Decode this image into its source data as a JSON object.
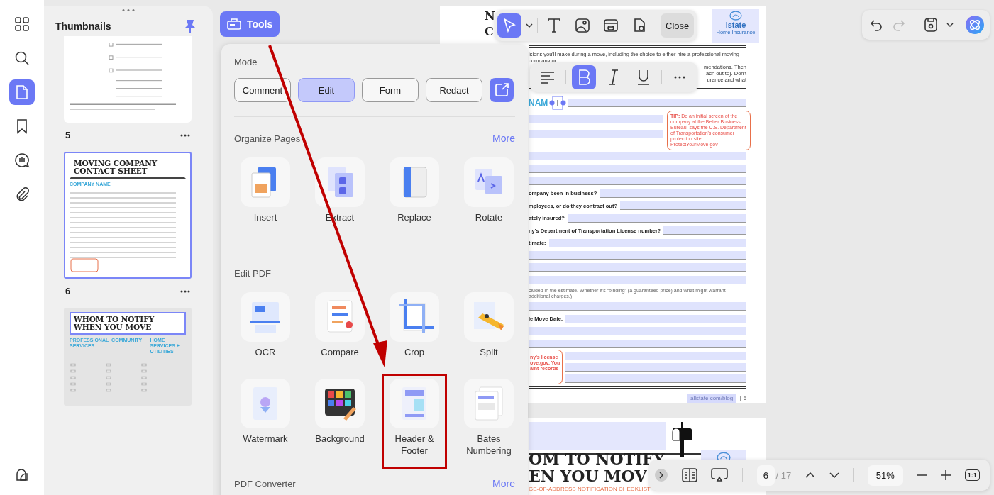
{
  "rail": {
    "items": [
      {
        "kind": "grid",
        "selected": false
      },
      {
        "kind": "search",
        "selected": false
      },
      {
        "kind": "pages",
        "selected": true
      },
      {
        "kind": "bookmark",
        "selected": false
      },
      {
        "kind": "comment",
        "selected": false
      },
      {
        "kind": "attachment",
        "selected": false
      }
    ]
  },
  "thumbnails": {
    "title": "Thumbnails",
    "pinned": true,
    "pages": [
      {
        "kind": "checklist",
        "label": "5",
        "selected": false
      },
      {
        "kind": "contact",
        "label": "6",
        "selected": true,
        "title": [
          "MOVING COMPANY",
          "CONTACT SHEET"
        ],
        "subtitle": "COMPANY NAME"
      },
      {
        "kind": "notify",
        "selected": false,
        "title_selected": true,
        "title": [
          "WHOM TO NOTIFY",
          "WHEN YOU MOVE"
        ],
        "columns": [
          "PROFESSIONAL SERVICES",
          "COMMUNITY",
          "HOME SERVICES + UTILITIES"
        ]
      }
    ]
  },
  "tools_button": {
    "label": "Tools",
    "selected": true
  },
  "panel": {
    "mode": {
      "title": "Mode",
      "buttons": [
        {
          "label": "Comment",
          "selected": false
        },
        {
          "label": "Edit",
          "selected": true
        },
        {
          "label": "Form",
          "selected": false
        },
        {
          "label": "Redact",
          "selected": false
        }
      ]
    },
    "sections": [
      {
        "title": "Organize Pages",
        "more": "More",
        "tools": [
          {
            "kind": "insert",
            "label": "Insert",
            "highlighted": false
          },
          {
            "kind": "extract",
            "label": "Extract",
            "highlighted": false
          },
          {
            "kind": "replace",
            "label": "Replace",
            "highlighted": false
          },
          {
            "kind": "rotate",
            "label": "Rotate",
            "highlighted": false
          }
        ]
      },
      {
        "title": "Edit PDF",
        "tools": [
          {
            "kind": "ocr",
            "label": "OCR",
            "highlighted": false
          },
          {
            "kind": "compare",
            "label": "Compare",
            "highlighted": false
          },
          {
            "kind": "crop",
            "label": "Crop",
            "highlighted": false
          },
          {
            "kind": "split",
            "label": "Split",
            "highlighted": false
          },
          {
            "kind": "watermark",
            "label": "Watermark",
            "highlighted": false
          },
          {
            "kind": "background",
            "label": "Background",
            "highlighted": false
          },
          {
            "kind": "header-footer",
            "label": "Header & Footer",
            "highlighted": true
          },
          {
            "kind": "bates",
            "label": "Bates Numbering",
            "highlighted": false
          }
        ]
      },
      {
        "title": "PDF Converter",
        "more": "More"
      }
    ]
  },
  "edit_toolbar": {
    "tools": [
      {
        "kind": "select",
        "selected": true
      },
      {
        "kind": "text",
        "selected": false
      },
      {
        "kind": "image",
        "selected": false
      },
      {
        "kind": "link",
        "selected": false
      },
      {
        "kind": "location",
        "selected": false
      }
    ],
    "close": "Close"
  },
  "format_toolbar": {
    "buttons": [
      {
        "kind": "align",
        "selected": false
      },
      {
        "kind": "bold",
        "selected": true
      },
      {
        "kind": "italic",
        "selected": false
      },
      {
        "kind": "underline",
        "selected": false
      },
      {
        "kind": "more",
        "selected": false
      }
    ]
  },
  "page_1": {
    "title_fragments": [
      "N",
      "C"
    ],
    "logo_lines": [
      "lstate",
      "Home Insurance"
    ],
    "intro": "isions you'll make during a move, including the choice to either hire a professional moving company or",
    "intro_fragments": [
      "mendations. Then",
      "ach out to). Don't",
      "urance and what"
    ],
    "section": "NAM",
    "tip": "**TIP:** Do an initial screen of the company at the Better Business Bureau, says the U.S. Department of Transportation's consumer protection site, ProtectYourMove.gov",
    "rows": [
      {
        "kind": "bar"
      },
      {
        "kind": "bar"
      },
      {
        "kind": "bar"
      },
      {
        "kind": "question",
        "label": "ompany been in business?"
      },
      {
        "kind": "question",
        "label": "mployees, or do they contract out?"
      },
      {
        "kind": "question",
        "label": "ately insured?"
      },
      {
        "kind": "question",
        "label": "ny's Department of Transportation License number?"
      },
      {
        "kind": "question",
        "label": "timate:"
      },
      {
        "kind": "bar"
      },
      {
        "kind": "bar"
      },
      {
        "kind": "bar"
      },
      {
        "kind": "note",
        "label": "cluded in the estimate. Whether it's “binding” (a guaranteed price) and what might warrant additional charges.)"
      },
      {
        "kind": "bar"
      },
      {
        "kind": "question",
        "label": "le Move Date:"
      },
      {
        "kind": "bar"
      },
      {
        "kind": "bar"
      }
    ],
    "side_tip": "ny's license ove.gov. You aint records",
    "footer_link": "allstate.com/blog",
    "page_number": "6"
  },
  "page_2": {
    "title": [
      "OM TO NOTIFY",
      "EN YOU MOV"
    ],
    "subtitle": "GE-OF-ADDRESS NOTIFICATION CHECKLIST"
  },
  "history": {
    "buttons": [
      {
        "kind": "undo",
        "disabled": false
      },
      {
        "kind": "redo",
        "disabled": true
      }
    ]
  },
  "nav": {
    "page": "6",
    "total": "/ 17",
    "zoom": "51%",
    "fit": "1:1"
  }
}
